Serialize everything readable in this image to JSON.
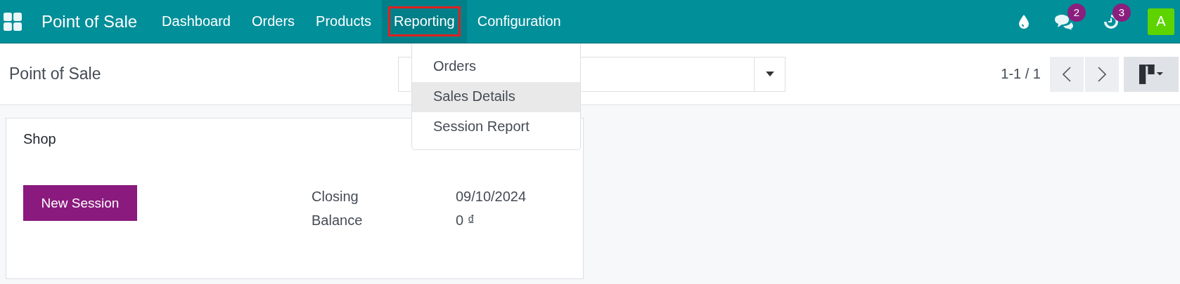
{
  "navbar": {
    "app_name": "Point of Sale",
    "menu": [
      {
        "label": "Dashboard",
        "selected": false,
        "outlined": false
      },
      {
        "label": "Orders",
        "selected": false,
        "outlined": false
      },
      {
        "label": "Products",
        "selected": false,
        "outlined": false
      },
      {
        "label": "Reporting",
        "selected": true,
        "outlined": true
      },
      {
        "label": "Configuration",
        "selected": false,
        "outlined": false
      }
    ],
    "messages_badge": "2",
    "activities_badge": "3",
    "avatar": "A"
  },
  "dropdown": {
    "items": [
      {
        "label": "Orders",
        "selected": false
      },
      {
        "label": "Sales Details",
        "selected": true
      },
      {
        "label": "Session Report",
        "selected": false
      }
    ]
  },
  "control_panel": {
    "title": "Point of Sale",
    "pager": "1-1 / 1"
  },
  "cards": [
    {
      "name": "Shop",
      "button": "New Session",
      "fields": [
        {
          "label": "Closing",
          "value": "09/10/2024"
        },
        {
          "label": "Balance",
          "value": "0 ₫"
        }
      ]
    }
  ]
}
